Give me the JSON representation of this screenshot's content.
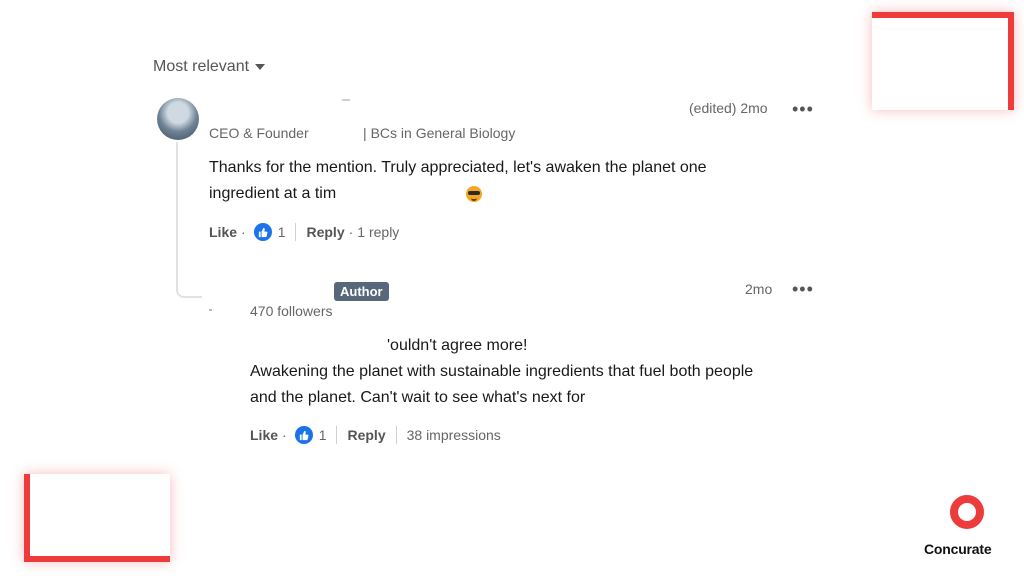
{
  "sort": {
    "label": "Most relevant"
  },
  "comments": [
    {
      "headline": "CEO & Founder              | BCs in General Biology",
      "timestamp": "(edited) 2mo",
      "more_label": "•••",
      "text_line1": "Thanks for the mention. Truly appreciated, let's awaken the planet one",
      "text_line2": "ingredient at a tim",
      "emoji": "sunglasses-emoji",
      "like_label": "Like",
      "like_count": "1",
      "reply_label": "Reply",
      "reply_count": "1 reply"
    },
    {
      "badge": "Author",
      "followers": "470 followers",
      "timestamp": "2mo",
      "more_label": "•••",
      "text_line1": "'ouldn't agree more!",
      "text_line2": "Awakening the planet with sustainable ingredients that fuel both people",
      "text_line3": "and the planet. Can't wait to see what's next for",
      "like_label": "Like",
      "like_count": "1",
      "reply_label": "Reply",
      "impressions": "38 impressions"
    }
  ],
  "brand": {
    "name": "Concurate",
    "accent": "#ee3b3b"
  }
}
